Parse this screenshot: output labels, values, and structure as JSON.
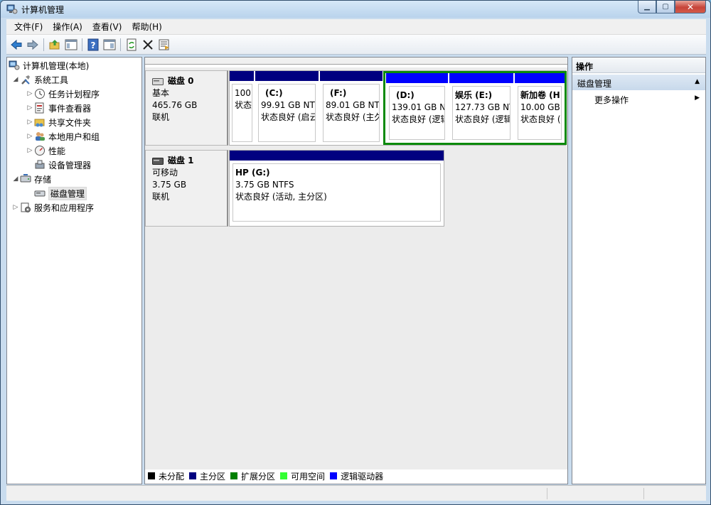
{
  "window": {
    "title": "计算机管理"
  },
  "menu": [
    "文件(F)",
    "操作(A)",
    "查看(V)",
    "帮助(H)"
  ],
  "toolbar": {
    "icons": [
      "back-arrow-icon",
      "forward-arrow-icon",
      "up-folder-icon",
      "show-tree-icon",
      "help-icon",
      "properties-icon",
      "refresh-icon",
      "delete-icon",
      "export-icon"
    ]
  },
  "tree": {
    "root": "计算机管理(本地)",
    "system_tools": "系统工具",
    "task_scheduler": "任务计划程序",
    "event_viewer": "事件查看器",
    "shared_folders": "共享文件夹",
    "local_users": "本地用户和组",
    "performance": "性能",
    "device_manager": "设备管理器",
    "storage": "存储",
    "disk_management": "磁盘管理",
    "services_apps": "服务和应用程序"
  },
  "disks": [
    {
      "name": "磁盘 0",
      "type": "基本",
      "size": "465.76 GB",
      "status": "联机",
      "partitions": [
        {
          "name": "",
          "size": "100",
          "state": "状态"
        },
        {
          "name": "(C:)",
          "size": "99.91 GB NT",
          "state": "状态良好 (启云"
        },
        {
          "name": "(F:)",
          "size": "89.01 GB NT",
          "state": "状态良好 (主久"
        },
        {
          "name": "(D:)",
          "size": "139.01 GB N",
          "state": "状态良好 (逻辑"
        },
        {
          "name": "娱乐  (E:)",
          "size": "127.73 GB NT",
          "state": "状态良好 (逻辑"
        },
        {
          "name": "新加卷  (H",
          "size": "10.00 GB",
          "state": "状态良好 ("
        }
      ]
    },
    {
      "name": "磁盘 1",
      "type": "可移动",
      "size": "3.75 GB",
      "status": "联机",
      "partitions": [
        {
          "name": "HP  (G:)",
          "size": "3.75 GB NTFS",
          "state": "状态良好 (活动, 主分区)"
        }
      ]
    }
  ],
  "legend": [
    {
      "label": "未分配",
      "color": "#000000"
    },
    {
      "label": "主分区",
      "color": "#000080"
    },
    {
      "label": "扩展分区",
      "color": "#008000"
    },
    {
      "label": "可用空间",
      "color": "#33ff33"
    },
    {
      "label": "逻辑驱动器",
      "color": "#0000ff"
    }
  ],
  "colors": {
    "primary_partition": "#000080",
    "logical_drive": "#0000ff",
    "extended_partition": "#0a8a0a"
  },
  "actions": {
    "header": "操作",
    "section": "磁盘管理",
    "more": "更多操作"
  }
}
